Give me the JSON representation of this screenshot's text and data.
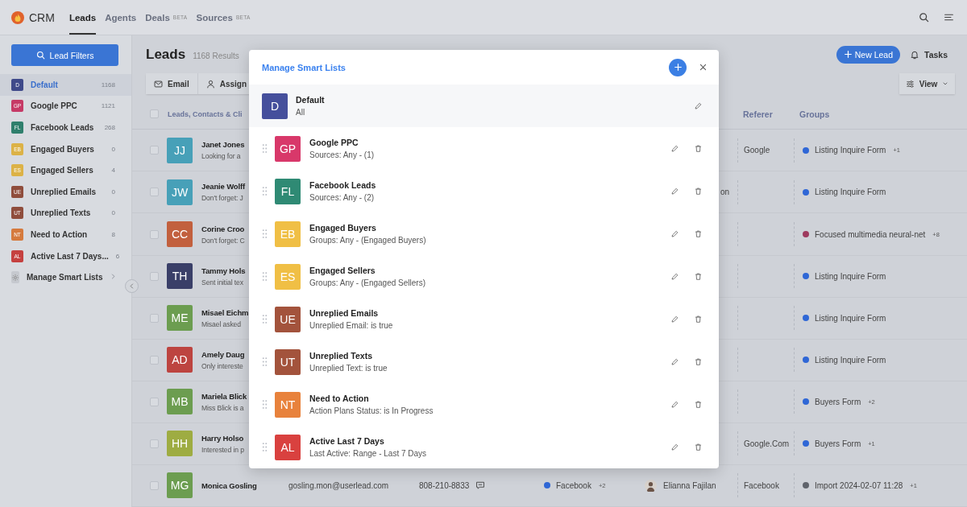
{
  "topbar": {
    "app_name": "CRM",
    "nav": [
      {
        "label": "Leads",
        "selected": true
      },
      {
        "label": "Agents",
        "selected": false
      },
      {
        "label": "Deals",
        "badge": "BETA",
        "selected": false
      },
      {
        "label": "Sources",
        "badge": "BETA",
        "selected": false
      }
    ]
  },
  "sidebar": {
    "filter_button": "Lead Filters",
    "smart_lists": [
      {
        "abbr": "D",
        "name": "Default",
        "count": "1168",
        "color": "#3f4a8a",
        "selected": true
      },
      {
        "abbr": "GP",
        "name": "Google PPC",
        "count": "1121",
        "color": "#c63a66",
        "selected": false
      },
      {
        "abbr": "FL",
        "name": "Facebook Leads",
        "count": "268",
        "color": "#2f7f6c",
        "selected": false
      },
      {
        "abbr": "EB",
        "name": "Engaged Buyers",
        "count": "0",
        "color": "#dcb246",
        "selected": false
      },
      {
        "abbr": "ES",
        "name": "Engaged Sellers",
        "count": "4",
        "color": "#dcb246",
        "selected": false
      },
      {
        "abbr": "UE",
        "name": "Unreplied Emails",
        "count": "0",
        "color": "#8f4d3c",
        "selected": false
      },
      {
        "abbr": "UT",
        "name": "Unreplied Texts",
        "count": "0",
        "color": "#8f4d3c",
        "selected": false
      },
      {
        "abbr": "NT",
        "name": "Need to Action",
        "count": "8",
        "color": "#d57a3d",
        "selected": false
      },
      {
        "abbr": "AL",
        "name": "Active Last 7 Days...",
        "count": "6",
        "color": "#c5403f",
        "selected": false
      }
    ],
    "manage_label": "Manage Smart Lists"
  },
  "main": {
    "title": "Leads",
    "results": "1168 Results",
    "new_button": "New Lead",
    "tasks": "Tasks",
    "actions": [
      {
        "kind": "email",
        "label": "Email"
      },
      {
        "kind": "assign",
        "label": "Assign"
      }
    ],
    "view_button": "View",
    "header_checked": false,
    "columns": [
      "Leads, Contacts & Cli",
      "Referer",
      "Groups"
    ],
    "rows": [
      {
        "checked": false,
        "initials": "JJ",
        "color": "#47a0b8",
        "name": "Janet Jones",
        "note": "Looking for a",
        "referer": "Google",
        "group": {
          "label": "Listing Inquire Form",
          "color": "#2f67d6",
          "more": "+1"
        }
      },
      {
        "checked": false,
        "initials": "JW",
        "color": "#47a0b8",
        "name": "Jeanie Wolff",
        "note": "Don't forget: J",
        "agent": {
          "name": "on",
          "photo": false
        },
        "group": {
          "label": "Listing Inquire Form",
          "color": "#2f67d6"
        }
      },
      {
        "checked": false,
        "initials": "CC",
        "color": "#c2603e",
        "name": "Corine Croo",
        "note": "Don't forget: C",
        "group": {
          "label": "Focused multimedia neural-net",
          "color": "#9e3a5e",
          "more": "+8"
        }
      },
      {
        "checked": false,
        "initials": "TH",
        "color": "#3a3f68",
        "name": "Tammy Hols",
        "note": "Sent initial tex",
        "group": {
          "label": "Listing Inquire Form",
          "color": "#2f67d6"
        }
      },
      {
        "checked": false,
        "initials": "ME",
        "color": "#6c9d50",
        "name": "Misael Eichm",
        "note": "Misael asked",
        "group": {
          "label": "Listing Inquire Form",
          "color": "#2f67d6"
        }
      },
      {
        "checked": false,
        "initials": "AD",
        "color": "#bd4440",
        "name": "Amely Daug",
        "note": "Only intereste",
        "group": {
          "label": "Listing Inquire Form",
          "color": "#2f67d6"
        }
      },
      {
        "checked": false,
        "initials": "MB",
        "color": "#6c9d50",
        "name": "Mariela Blick",
        "note": "Miss Blick is a",
        "group": {
          "label": "Buyers Form",
          "color": "#2f67d6",
          "more": "+2"
        }
      },
      {
        "checked": false,
        "initials": "HH",
        "color": "#9eac42",
        "name": "Harry Holso",
        "note": "Interested in p",
        "referer": "Google.Com",
        "group": {
          "label": "Buyers Form",
          "color": "#2f67d6",
          "more": "+1"
        }
      },
      {
        "checked": false,
        "initials": "MG",
        "color": "#6c9d50",
        "name": "Monica Gosling",
        "email": "gosling.mon@userlead.com",
        "phone": "808-210-8833",
        "source": {
          "label": "Facebook",
          "color": "#2f67d6",
          "more": "+2"
        },
        "agent": {
          "name": "Elianna Fajilan",
          "photo": true
        },
        "referer": "Facebook",
        "group": {
          "label": "Import 2024-02-07 11:28",
          "color": "#5f636b",
          "more": "+1"
        }
      }
    ]
  },
  "modal": {
    "title": "Manage Smart Lists",
    "items": [
      {
        "kind": "default",
        "abbr": "D",
        "color": "#454f9c",
        "name": "Default",
        "rule": "All"
      },
      {
        "kind": "custom",
        "abbr": "GP",
        "color": "#d8386a",
        "name": "Google PPC",
        "rule": "Sources: Any - (1)"
      },
      {
        "kind": "custom",
        "abbr": "FL",
        "color": "#2f8a74",
        "name": "Facebook Leads",
        "rule": "Sources: Any - (2)"
      },
      {
        "kind": "custom",
        "abbr": "EB",
        "color": "#f0bf45",
        "name": "Engaged Buyers",
        "rule": "Groups: Any - (Engaged Buyers)"
      },
      {
        "kind": "custom",
        "abbr": "ES",
        "color": "#f0bf45",
        "name": "Engaged Sellers",
        "rule": "Groups: Any - (Engaged Sellers)"
      },
      {
        "kind": "custom",
        "abbr": "UE",
        "color": "#a3533c",
        "name": "Unreplied Emails",
        "rule": "Unreplied Email: is true"
      },
      {
        "kind": "custom",
        "abbr": "UT",
        "color": "#a3533c",
        "name": "Unreplied Texts",
        "rule": "Unreplied Text: is true"
      },
      {
        "kind": "custom",
        "abbr": "NT",
        "color": "#e8823c",
        "name": "Need to Action",
        "rule": "Action Plans Status: is In Progress"
      },
      {
        "kind": "custom",
        "abbr": "AL",
        "color": "#d9413f",
        "name": "Active Last 7 Days",
        "rule": "Last Active: Range - Last 7 Days"
      }
    ]
  }
}
